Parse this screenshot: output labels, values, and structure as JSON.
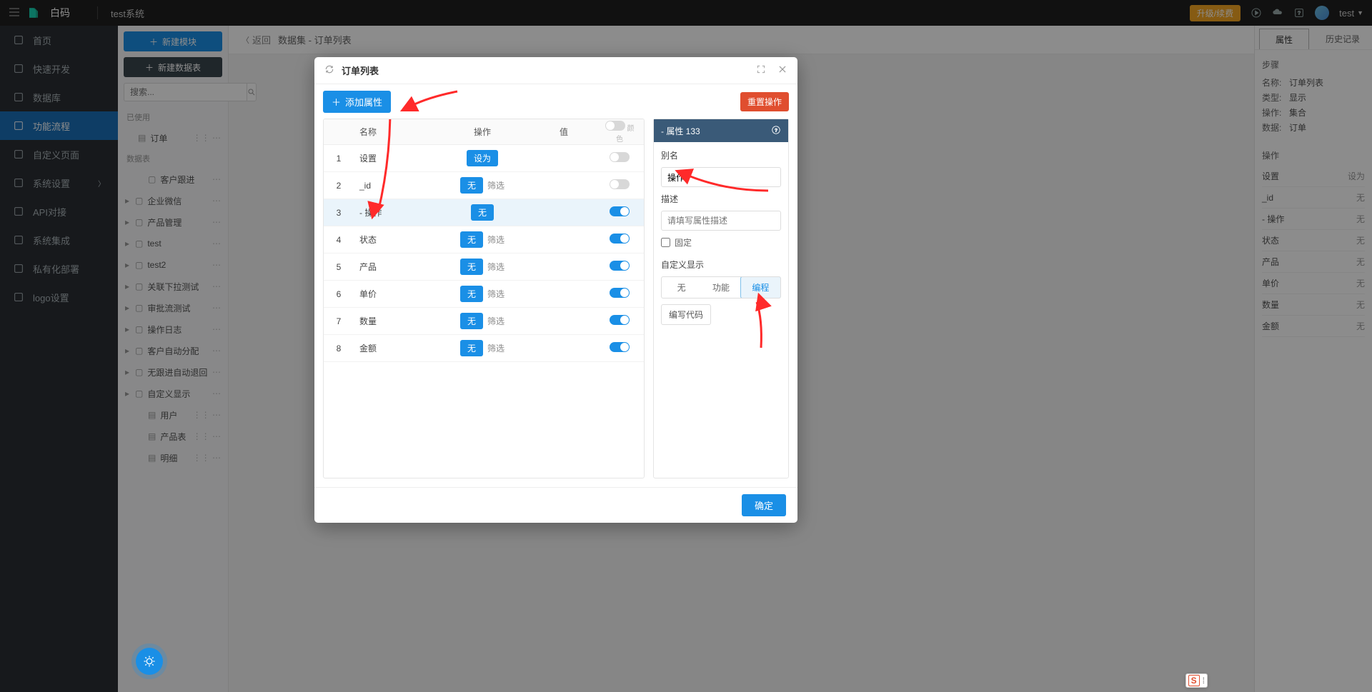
{
  "topbar": {
    "brand": "白码",
    "system_name": "test系统",
    "upgrade_label": "升级/续费",
    "user_name": "test"
  },
  "leftnav": [
    {
      "label": "首页",
      "icon": "home"
    },
    {
      "label": "快速开发",
      "icon": "cube"
    },
    {
      "label": "数据库",
      "icon": "db"
    },
    {
      "label": "功能流程",
      "icon": "flow",
      "active": true
    },
    {
      "label": "自定义页面",
      "icon": "page"
    },
    {
      "label": "系统设置",
      "icon": "gear",
      "arrow": true
    },
    {
      "label": "API对接",
      "icon": "api"
    },
    {
      "label": "系统集成",
      "icon": "sys"
    },
    {
      "label": "私有化部署",
      "icon": "deploy"
    },
    {
      "label": "logo设置",
      "icon": "logo"
    }
  ],
  "sidebar2": {
    "btn_new_module": "新建模块",
    "btn_new_table": "新建数据表",
    "search_placeholder": "搜索...",
    "used_label": "已使用",
    "used_items": [
      {
        "label": "订单",
        "type": "file"
      }
    ],
    "datatable_label": "数据表",
    "datatables": [
      {
        "label": "客户跟进",
        "type": "folder",
        "child": true
      },
      {
        "label": "企业微信",
        "type": "folder",
        "exp": true
      },
      {
        "label": "产品管理",
        "type": "folder",
        "exp": true
      },
      {
        "label": "test",
        "type": "folder",
        "exp": true
      },
      {
        "label": "test2",
        "type": "folder",
        "exp": true
      },
      {
        "label": "关联下拉测试",
        "type": "folder",
        "exp": true
      },
      {
        "label": "审批流测试",
        "type": "folder",
        "exp": true
      },
      {
        "label": "操作日志",
        "type": "folder",
        "exp": true
      },
      {
        "label": "客户自动分配",
        "type": "folder",
        "exp": true
      },
      {
        "label": "无跟进自动退回",
        "type": "folder",
        "exp": true
      },
      {
        "label": "自定义显示",
        "type": "folder",
        "exp": true
      },
      {
        "label": "用户",
        "type": "file",
        "child": true
      },
      {
        "label": "产品表",
        "type": "file",
        "child": true
      },
      {
        "label": "明细",
        "type": "file",
        "child": true
      }
    ]
  },
  "breadcrumb": {
    "back": "返回",
    "path": "数据集 - 订单列表"
  },
  "right_panel": {
    "tab_prop": "属性",
    "tab_history": "历史记录",
    "step_label": "步骤",
    "rows": [
      {
        "k": "名称:",
        "v": "订单列表"
      },
      {
        "k": "类型:",
        "v": "显示"
      },
      {
        "k": "操作:",
        "v": "集合"
      },
      {
        "k": "数据:",
        "v": "订单"
      }
    ],
    "ops_label": "操作",
    "ops": [
      {
        "name": "设置",
        "right": "设为"
      },
      {
        "name": "_id",
        "right": "无"
      },
      {
        "name": "- 操作",
        "right": "无"
      },
      {
        "name": "状态",
        "right": "无"
      },
      {
        "name": "产品",
        "right": "无"
      },
      {
        "name": "单价",
        "right": "无"
      },
      {
        "name": "数量",
        "right": "无"
      },
      {
        "name": "金额",
        "right": "无"
      }
    ]
  },
  "modal": {
    "title": "订单列表",
    "add_attr": "添加属性",
    "reset": "重置操作",
    "confirm": "确定",
    "header_toggle_label": "颜色",
    "columns": {
      "name": "名称",
      "op": "操作",
      "val": "值"
    },
    "rows": [
      {
        "n": 1,
        "name": "设置",
        "op_tag": "设为",
        "filter": "",
        "switch": "off"
      },
      {
        "n": 2,
        "name": "_id",
        "op_tag": "无",
        "filter": "筛选",
        "switch": "off"
      },
      {
        "n": 3,
        "name": "- 操作",
        "op_tag": "无",
        "filter": "",
        "switch": "on",
        "selected": true
      },
      {
        "n": 4,
        "name": "状态",
        "op_tag": "无",
        "filter": "筛选",
        "switch": "on"
      },
      {
        "n": 5,
        "name": "产品",
        "op_tag": "无",
        "filter": "筛选",
        "switch": "on"
      },
      {
        "n": 6,
        "name": "单价",
        "op_tag": "无",
        "filter": "筛选",
        "switch": "on"
      },
      {
        "n": 7,
        "name": "数量",
        "op_tag": "无",
        "filter": "筛选",
        "switch": "on"
      },
      {
        "n": 8,
        "name": "金额",
        "op_tag": "无",
        "filter": "筛选",
        "switch": "on"
      }
    ],
    "prop": {
      "header": "- 属性 133",
      "alias_label": "别名",
      "alias_value": "操作",
      "desc_label": "描述",
      "desc_placeholder": "请填写属性描述",
      "fixed_label": "固定",
      "custom_display_label": "自定义显示",
      "seg_none": "无",
      "seg_fn": "功能",
      "seg_code": "编程",
      "write_code": "编写代码"
    }
  },
  "ime": {
    "letter": "S",
    "sym": "⁞"
  }
}
